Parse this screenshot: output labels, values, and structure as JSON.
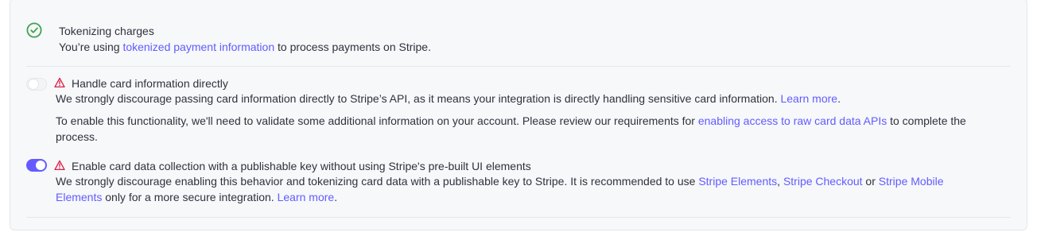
{
  "colors": {
    "accent": "#635bff",
    "success": "#3fa34d",
    "warning": "#df1b41"
  },
  "items": [
    {
      "icon": "check-circle-icon",
      "title": "Tokenizing charges",
      "desc_pre": "You’re using ",
      "desc_link": "tokenized payment information",
      "desc_post": " to process payments on Stripe."
    },
    {
      "toggle_on": false,
      "icon": "warning-icon",
      "title": "Handle card information directly",
      "desc_pre": "We strongly discourage passing card information directly to Stripe’s API, as it means your integration is directly handling sensitive card information. ",
      "desc_link": "Learn more",
      "desc_post": ".",
      "note_pre": "To enable this functionality, we'll need to validate some additional information on your account. Please review our requirements for ",
      "note_link": "enabling access to raw card data APIs",
      "note_post": " to complete the",
      "note_line2": "process."
    },
    {
      "toggle_on": true,
      "icon": "warning-icon",
      "title": "Enable card data collection with a publishable key without using Stripe's pre-built UI elements",
      "desc_pre": "We strongly discourage enabling this behavior and tokenizing card data with a publishable key to Stripe. It is recommended to use ",
      "link_elements": "Stripe Elements",
      "sep1": ", ",
      "link_checkout": "Stripe Checkout",
      "sep2": " or ",
      "link_mobile_1": "Stripe Mobile",
      "link_mobile_2": "Elements",
      "desc_post": " only for a more secure integration. ",
      "desc_link": "Learn more",
      "desc_end": "."
    }
  ]
}
